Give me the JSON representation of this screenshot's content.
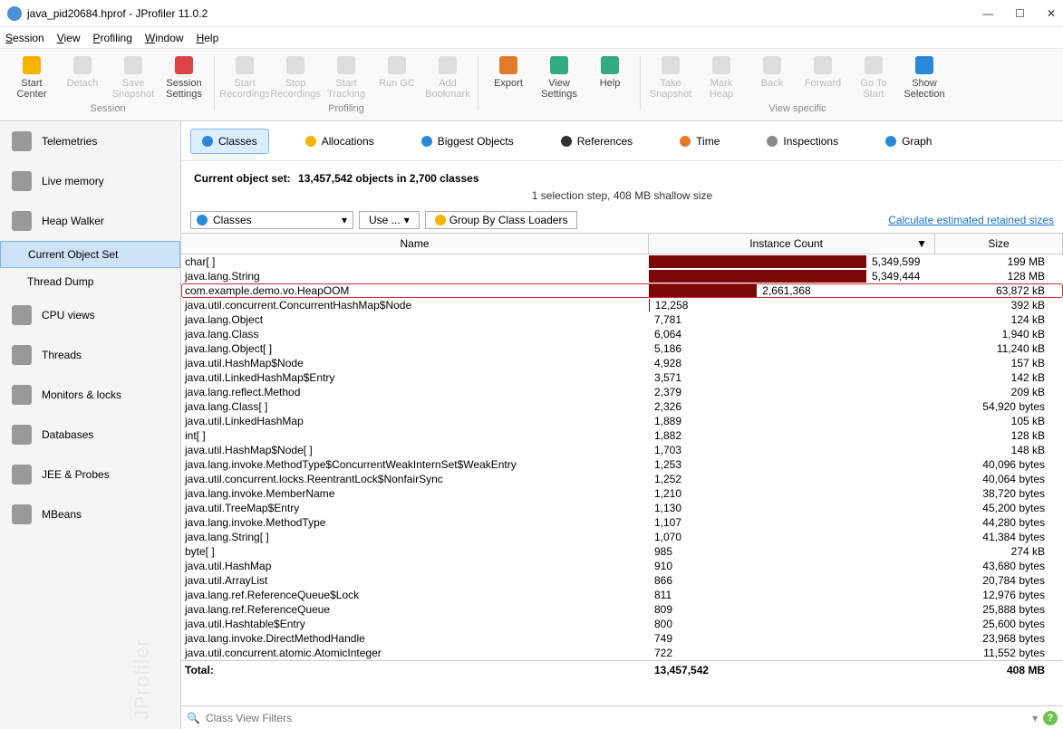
{
  "window": {
    "title": "java_pid20684.hprof - JProfiler 11.0.2"
  },
  "menu": [
    "Session",
    "View",
    "Profiling",
    "Window",
    "Help"
  ],
  "toolbar_groups": [
    {
      "label": "Session",
      "buttons": [
        {
          "id": "start-center",
          "label": "Start\nCenter",
          "enabled": true,
          "color": "#f5b400"
        },
        {
          "id": "detach",
          "label": "Detach",
          "enabled": false
        },
        {
          "id": "save-snapshot",
          "label": "Save\nSnapshot",
          "enabled": false
        },
        {
          "id": "session-settings",
          "label": "Session\nSettings",
          "enabled": true,
          "color": "#d44"
        }
      ]
    },
    {
      "label": "Profiling",
      "buttons": [
        {
          "id": "start-recordings",
          "label": "Start\nRecordings",
          "enabled": false
        },
        {
          "id": "stop-recordings",
          "label": "Stop\nRecordings",
          "enabled": false
        },
        {
          "id": "start-tracking",
          "label": "Start\nTracking",
          "enabled": false
        },
        {
          "id": "run-gc",
          "label": "Run GC",
          "enabled": false
        },
        {
          "id": "add-bookmark",
          "label": "Add\nBookmark",
          "enabled": false
        }
      ]
    },
    {
      "label": "",
      "buttons": [
        {
          "id": "export",
          "label": "Export",
          "enabled": true,
          "color": "#e07b2a"
        },
        {
          "id": "view-settings",
          "label": "View\nSettings",
          "enabled": true,
          "color": "#3a8"
        },
        {
          "id": "help",
          "label": "Help",
          "enabled": true,
          "color": "#3a8"
        }
      ]
    },
    {
      "label": "View specific",
      "buttons": [
        {
          "id": "take-snapshot",
          "label": "Take\nSnapshot",
          "enabled": false
        },
        {
          "id": "mark-heap",
          "label": "Mark\nHeap",
          "enabled": false
        },
        {
          "id": "back",
          "label": "Back",
          "enabled": false
        },
        {
          "id": "forward",
          "label": "Forward",
          "enabled": false
        },
        {
          "id": "go-to-start",
          "label": "Go To\nStart",
          "enabled": false
        },
        {
          "id": "show-selection",
          "label": "Show\nSelection",
          "enabled": true,
          "color": "#2a88d8"
        }
      ]
    }
  ],
  "sidebar": [
    {
      "id": "telemetries",
      "label": "Telemetries"
    },
    {
      "id": "live-memory",
      "label": "Live memory"
    },
    {
      "id": "heap-walker",
      "label": "Heap Walker"
    },
    {
      "id": "current-object-set",
      "label": "Current Object Set",
      "sub": true,
      "active": true
    },
    {
      "id": "thread-dump",
      "label": "Thread Dump",
      "sub": true
    },
    {
      "id": "cpu-views",
      "label": "CPU views"
    },
    {
      "id": "threads",
      "label": "Threads"
    },
    {
      "id": "monitors-locks",
      "label": "Monitors & locks"
    },
    {
      "id": "databases",
      "label": "Databases"
    },
    {
      "id": "jee-probes",
      "label": "JEE & Probes"
    },
    {
      "id": "mbeans",
      "label": "MBeans"
    }
  ],
  "watermark": "JProfiler",
  "tabs": [
    {
      "id": "classes",
      "label": "Classes",
      "active": true,
      "color": "#2a88d8"
    },
    {
      "id": "allocations",
      "label": "Allocations",
      "color": "#f5b400"
    },
    {
      "id": "biggest-objects",
      "label": "Biggest Objects",
      "color": "#2a88d8"
    },
    {
      "id": "references",
      "label": "References",
      "color": "#333"
    },
    {
      "id": "time",
      "label": "Time",
      "color": "#e07b2a"
    },
    {
      "id": "inspections",
      "label": "Inspections",
      "color": "#888"
    },
    {
      "id": "graph",
      "label": "Graph",
      "color": "#2a88d8"
    }
  ],
  "summary": {
    "heading_prefix": "Current object set:",
    "heading_value": "13,457,542 objects in 2,700 classes",
    "subtext": "1 selection step, 408 MB shallow size"
  },
  "controls": {
    "selector": "Classes",
    "use_btn": "Use ...",
    "group_btn": "Group By Class Loaders",
    "link": "Calculate estimated retained sizes"
  },
  "columns": {
    "name": "Name",
    "count": "Instance Count",
    "size": "Size"
  },
  "max_count": 5349599,
  "rows": [
    {
      "name": "char[ ]",
      "count": "5,349,599",
      "bar": 1.0,
      "size": "199 MB"
    },
    {
      "name": "java.lang.String",
      "count": "5,349,444",
      "bar": 1.0,
      "size": "128 MB"
    },
    {
      "name": "com.example.demo.vo.HeapOOM",
      "count": "2,661,368",
      "bar": 0.497,
      "size": "63,872 kB",
      "highlight": true
    },
    {
      "name": "java.util.concurrent.ConcurrentHashMap$Node",
      "count": "12,258",
      "bar": 0.003,
      "size": "392 kB"
    },
    {
      "name": "java.lang.Object",
      "count": "7,781",
      "bar": 0.002,
      "size": "124 kB"
    },
    {
      "name": "java.lang.Class",
      "count": "6,064",
      "bar": 0.001,
      "size": "1,940 kB"
    },
    {
      "name": "java.lang.Object[ ]",
      "count": "5,186",
      "bar": 0.001,
      "size": "11,240 kB"
    },
    {
      "name": "java.util.HashMap$Node",
      "count": "4,928",
      "bar": 0.001,
      "size": "157 kB"
    },
    {
      "name": "java.util.LinkedHashMap$Entry",
      "count": "3,571",
      "bar": 0.001,
      "size": "142 kB"
    },
    {
      "name": "java.lang.reflect.Method",
      "count": "2,379",
      "bar": 0,
      "size": "209 kB"
    },
    {
      "name": "java.lang.Class[ ]",
      "count": "2,326",
      "bar": 0,
      "size": "54,920 bytes"
    },
    {
      "name": "java.util.LinkedHashMap",
      "count": "1,889",
      "bar": 0,
      "size": "105 kB"
    },
    {
      "name": "int[ ]",
      "count": "1,882",
      "bar": 0,
      "size": "128 kB"
    },
    {
      "name": "java.util.HashMap$Node[ ]",
      "count": "1,703",
      "bar": 0,
      "size": "148 kB"
    },
    {
      "name": "java.lang.invoke.MethodType$ConcurrentWeakInternSet$WeakEntry",
      "count": "1,253",
      "bar": 0,
      "size": "40,096 bytes"
    },
    {
      "name": "java.util.concurrent.locks.ReentrantLock$NonfairSync",
      "count": "1,252",
      "bar": 0,
      "size": "40,064 bytes"
    },
    {
      "name": "java.lang.invoke.MemberName",
      "count": "1,210",
      "bar": 0,
      "size": "38,720 bytes"
    },
    {
      "name": "java.util.TreeMap$Entry",
      "count": "1,130",
      "bar": 0,
      "size": "45,200 bytes"
    },
    {
      "name": "java.lang.invoke.MethodType",
      "count": "1,107",
      "bar": 0,
      "size": "44,280 bytes"
    },
    {
      "name": "java.lang.String[ ]",
      "count": "1,070",
      "bar": 0,
      "size": "41,384 bytes"
    },
    {
      "name": "byte[ ]",
      "count": "985",
      "bar": 0,
      "size": "274 kB"
    },
    {
      "name": "java.util.HashMap",
      "count": "910",
      "bar": 0,
      "size": "43,680 bytes"
    },
    {
      "name": "java.util.ArrayList",
      "count": "866",
      "bar": 0,
      "size": "20,784 bytes"
    },
    {
      "name": "java.lang.ref.ReferenceQueue$Lock",
      "count": "811",
      "bar": 0,
      "size": "12,976 bytes"
    },
    {
      "name": "java.lang.ref.ReferenceQueue",
      "count": "809",
      "bar": 0,
      "size": "25,888 bytes"
    },
    {
      "name": "java.util.Hashtable$Entry",
      "count": "800",
      "bar": 0,
      "size": "25,600 bytes"
    },
    {
      "name": "java.lang.invoke.DirectMethodHandle",
      "count": "749",
      "bar": 0,
      "size": "23,968 bytes"
    },
    {
      "name": "java.util.concurrent.atomic.AtomicInteger",
      "count": "722",
      "bar": 0,
      "size": "11,552 bytes"
    }
  ],
  "total": {
    "label": "Total:",
    "count": "13,457,542",
    "size": "408 MB"
  },
  "filter_placeholder": "Class View Filters"
}
